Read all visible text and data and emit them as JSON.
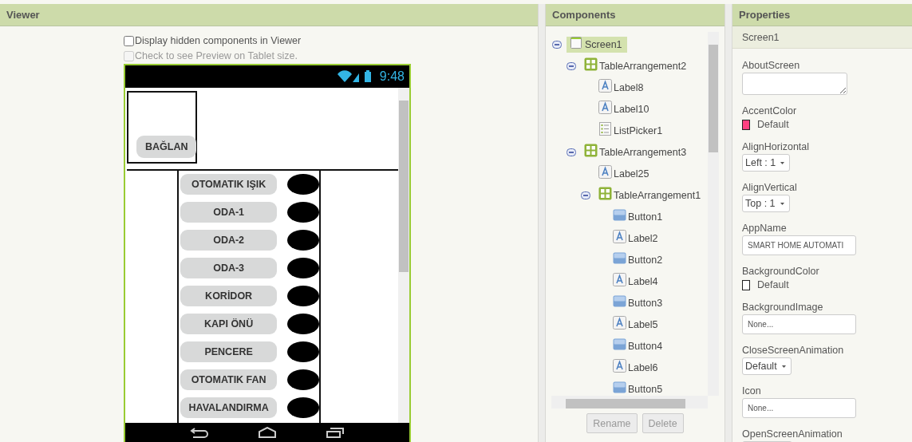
{
  "viewer": {
    "title": "Viewer",
    "options": [
      {
        "label": "Display hidden components in Viewer",
        "checked": false,
        "disabled": false
      },
      {
        "label": "Check to see Preview on Tablet size.",
        "checked": false,
        "disabled": true
      }
    ],
    "phone": {
      "time": "9:48",
      "top_button": "BAĞLAN",
      "rows": [
        {
          "label": "OTOMATIK IŞIK"
        },
        {
          "label": "ODA-1"
        },
        {
          "label": "ODA-2"
        },
        {
          "label": "ODA-3"
        },
        {
          "label": "KORİDOR"
        },
        {
          "label": "KAPI ÖNÜ"
        },
        {
          "label": "PENCERE"
        },
        {
          "label": "OTOMATIK FAN"
        },
        {
          "label": "HAVALANDIRMA"
        }
      ]
    }
  },
  "components": {
    "title": "Components",
    "tree": [
      {
        "name": "Screen1",
        "kind": "screen",
        "selected": true,
        "expanded": true,
        "children": [
          {
            "name": "TableArrangement2",
            "kind": "arrangement",
            "selected": false,
            "expanded": true,
            "children": [
              {
                "name": "Label8",
                "kind": "label",
                "selected": false
              },
              {
                "name": "Label10",
                "kind": "label",
                "selected": false
              },
              {
                "name": "ListPicker1",
                "kind": "listpicker",
                "selected": false
              }
            ]
          },
          {
            "name": "TableArrangement3",
            "kind": "arrangement",
            "selected": false,
            "expanded": true,
            "children": [
              {
                "name": "Label25",
                "kind": "label",
                "selected": false
              },
              {
                "name": "TableArrangement1",
                "kind": "arrangement",
                "selected": false,
                "expanded": true,
                "children": [
                  {
                    "name": "Button1",
                    "kind": "button",
                    "selected": false
                  },
                  {
                    "name": "Label2",
                    "kind": "label",
                    "selected": false
                  },
                  {
                    "name": "Button2",
                    "kind": "button",
                    "selected": false
                  },
                  {
                    "name": "Label4",
                    "kind": "label",
                    "selected": false
                  },
                  {
                    "name": "Button3",
                    "kind": "button",
                    "selected": false
                  },
                  {
                    "name": "Label5",
                    "kind": "label",
                    "selected": false
                  },
                  {
                    "name": "Button4",
                    "kind": "button",
                    "selected": false
                  },
                  {
                    "name": "Label6",
                    "kind": "label",
                    "selected": false
                  },
                  {
                    "name": "Button5",
                    "kind": "button",
                    "selected": false
                  }
                ]
              }
            ]
          }
        ]
      }
    ],
    "buttons": [
      {
        "label": "Rename",
        "disabled": true
      },
      {
        "label": "Delete",
        "disabled": true
      }
    ]
  },
  "properties": {
    "title": "Properties",
    "component": "Screen1",
    "items": [
      {
        "label": "AboutScreen",
        "kind": "textarea"
      },
      {
        "label": "AccentColor",
        "kind": "color",
        "value": "Default",
        "color": "#ff4081"
      },
      {
        "label": "AlignHorizontal",
        "kind": "dropdown",
        "value": "Left : 1"
      },
      {
        "label": "AlignVertical",
        "kind": "dropdown",
        "value": "Top : 1"
      },
      {
        "label": "AppName",
        "kind": "text",
        "value": "SMART HOME AUTOMATI"
      },
      {
        "label": "BackgroundColor",
        "kind": "color",
        "value": "Default",
        "color": "#ffffff"
      },
      {
        "label": "BackgroundImage",
        "kind": "asset",
        "value": "None..."
      },
      {
        "label": "CloseScreenAnimation",
        "kind": "dropdown",
        "value": "Default"
      },
      {
        "label": "Icon",
        "kind": "asset",
        "value": "None..."
      },
      {
        "label": "OpenScreenAnimation",
        "kind": "dropdown"
      }
    ]
  }
}
